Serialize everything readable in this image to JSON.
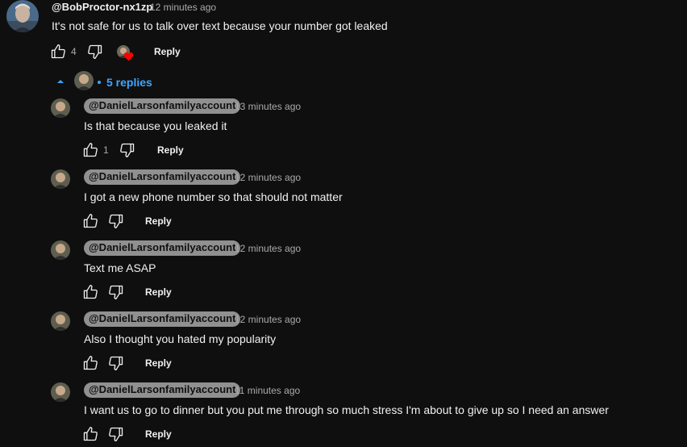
{
  "parent": {
    "handle": "@BobProctor-nx1zp",
    "time": "12 minutes ago",
    "text": "It's not safe for us to talk over text because your number got leaked",
    "likes": "4",
    "reply_label": "Reply"
  },
  "thread": {
    "replies_label": "5 replies"
  },
  "replies": [
    {
      "handle": "@DanielLarsonfamilyaccount",
      "time": "13 minutes ago",
      "text": "Is that because you leaked it",
      "likes": "1",
      "reply_label": "Reply"
    },
    {
      "handle": "@DanielLarsonfamilyaccount",
      "time": "12 minutes ago",
      "text": "I got a new phone number so that should not matter",
      "likes": "",
      "reply_label": "Reply"
    },
    {
      "handle": "@DanielLarsonfamilyaccount",
      "time": "12 minutes ago",
      "text": "Text me ASAP",
      "likes": "",
      "reply_label": "Reply"
    },
    {
      "handle": "@DanielLarsonfamilyaccount",
      "time": "12 minutes ago",
      "text": "Also I thought you hated my popularity",
      "likes": "",
      "reply_label": "Reply"
    },
    {
      "handle": "@DanielLarsonfamilyaccount",
      "time": "11 minutes ago",
      "text": "I want us to go to dinner but you put me through so much stress I'm about to give up so I need an answer",
      "likes": "",
      "reply_label": "Reply"
    }
  ],
  "colors": {
    "background": "#0f0f0f",
    "link_blue": "#3ea6ff",
    "pill_gray": "#909090",
    "heart_red": "#ff0000"
  },
  "icons": [
    "thumb-up-icon",
    "thumb-down-icon",
    "heart-icon",
    "chevron-up-icon"
  ]
}
